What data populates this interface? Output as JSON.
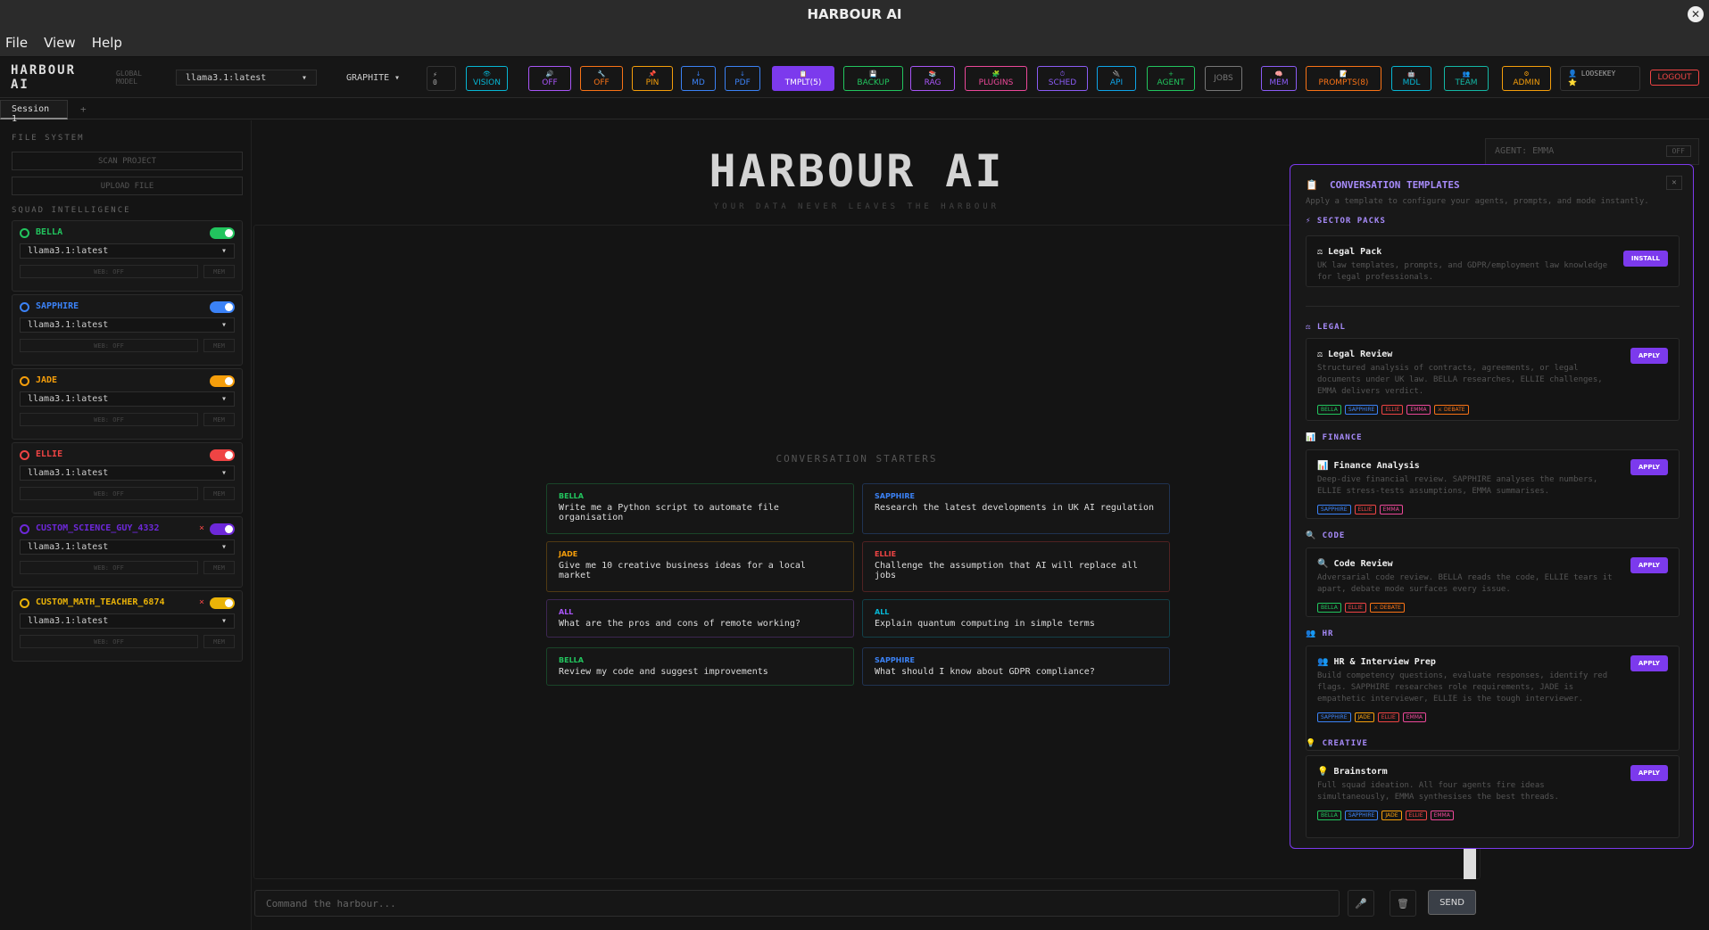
{
  "window": {
    "title": "HARBOUR AI",
    "close_glyph": "✕"
  },
  "menu": [
    "File",
    "View",
    "Help"
  ],
  "toolbar": {
    "brand": "HARBOUR AI",
    "global_model_label": "GLOBAL MODEL",
    "global_model": "llama3.1:latest",
    "theme": "GRAPHITE",
    "counter_icon": "⚡",
    "counter_value": "0",
    "buttons": [
      {
        "icon": "👁",
        "label": "VISION",
        "color": "#06b6d4"
      },
      {
        "icon": "🔊",
        "label": "OFF",
        "color": "#a855f7"
      },
      {
        "icon": "🔧",
        "label": "OFF",
        "color": "#f97316"
      },
      {
        "icon": "📌",
        "label": "PIN",
        "color": "#f59e0b"
      },
      {
        "icon": "↓",
        "label": "MD",
        "color": "#3b82f6"
      },
      {
        "icon": "↓",
        "label": "PDF",
        "color": "#3b82f6"
      },
      {
        "icon": "📋",
        "label": "TMPLT(5)",
        "color": "#7c3aed"
      },
      {
        "icon": "💾",
        "label": "BACKUP",
        "color": "#22c55e"
      },
      {
        "icon": "📚",
        "label": "RAG",
        "color": "#a855f7"
      },
      {
        "icon": "🧩",
        "label": "PLUGINS",
        "color": "#ec4899"
      },
      {
        "icon": "⏱",
        "label": "SCHED",
        "color": "#8b5cf6"
      },
      {
        "icon": "🔌",
        "label": "API",
        "color": "#0ea5e9"
      },
      {
        "icon": "+",
        "label": "AGENT",
        "color": "#22c55e"
      },
      {
        "icon": "",
        "label": "JOBS",
        "color": "#777777"
      },
      {
        "icon": "🧠",
        "label": "MEM",
        "color": "#8b5cf6"
      },
      {
        "icon": "📝",
        "label": "PROMPTS(8)",
        "color": "#f97316"
      },
      {
        "icon": "🤖",
        "label": "MDL",
        "color": "#06b6d4"
      },
      {
        "icon": "👥",
        "label": "TEAM",
        "color": "#14b8a6"
      },
      {
        "icon": "⚙",
        "label": "ADMIN",
        "color": "#f59e0b"
      }
    ],
    "user": "LOOSEKEY",
    "user_star": "⭐",
    "logout": "LOGOUT"
  },
  "tabs": {
    "session": "Session 1",
    "add": "+"
  },
  "sidebar": {
    "file_system_title": "FILE SYSTEM",
    "scan": "SCAN PROJECT",
    "upload": "UPLOAD FILE",
    "squad_title": "SQUAD INTELLIGENCE",
    "agents": [
      {
        "name": "BELLA",
        "color": "#22c55e",
        "model": "llama3.1:latest",
        "web": "WEB: OFF",
        "mem": "MEM",
        "custom": false
      },
      {
        "name": "SAPPHIRE",
        "color": "#3b82f6",
        "model": "llama3.1:latest",
        "web": "WEB: OFF",
        "mem": "MEM",
        "custom": false
      },
      {
        "name": "JADE",
        "color": "#f59e0b",
        "model": "llama3.1:latest",
        "web": "WEB: OFF",
        "mem": "MEM",
        "custom": false
      },
      {
        "name": "ELLIE",
        "color": "#ef4444",
        "model": "llama3.1:latest",
        "web": "WEB: OFF",
        "mem": "MEM",
        "custom": false
      },
      {
        "name": "CUSTOM_SCIENCE_GUY_4332",
        "color": "#6d28d9",
        "model": "llama3.1:latest",
        "web": "WEB: OFF",
        "mem": "MEM",
        "custom": true
      },
      {
        "name": "CUSTOM_MATH_TEACHER_6874",
        "color": "#eab308",
        "model": "llama3.1:latest",
        "web": "WEB: OFF",
        "mem": "MEM",
        "custom": true
      }
    ]
  },
  "main": {
    "hero_title": "HARBOUR AI",
    "hero_sub": "YOUR DATA NEVER LEAVES THE HARBOUR",
    "starters_title": "CONVERSATION STARTERS",
    "starters": [
      {
        "who": "BELLA",
        "text": "Write me a Python script to automate file organisation",
        "color": "#22c55e"
      },
      {
        "who": "SAPPHIRE",
        "text": "Research the latest developments in UK AI regulation",
        "color": "#3b82f6"
      },
      {
        "who": "JADE",
        "text": "Give me 10 creative business ideas for a local market",
        "color": "#f59e0b"
      },
      {
        "who": "ELLIE",
        "text": "Challenge the assumption that AI will replace all jobs",
        "color": "#ef4444"
      },
      {
        "who": "ALL",
        "text": "What are the pros and cons of remote working?",
        "color": "#a855f7"
      },
      {
        "who": "ALL",
        "text": "Explain quantum computing in simple terms",
        "color": "#06b6d4"
      },
      {
        "who": "BELLA",
        "text": "Review my code and suggest improvements",
        "color": "#22c55e"
      },
      {
        "who": "SAPPHIRE",
        "text": "What should I know about GDPR compliance?",
        "color": "#3b82f6"
      }
    ],
    "command_placeholder": "Command the harbour...",
    "mic_icon": "🎤",
    "trash_icon": "🗑",
    "send": "SEND",
    "emma_label": "AGENT: EMMA",
    "emma_state": "OFF"
  },
  "templates": {
    "title": "CONVERSATION TEMPLATES",
    "title_icon": "📋",
    "close": "✕",
    "subtitle": "Apply a template to configure your agents, prompts, and mode instantly.",
    "sector_title": "⚡ SECTOR PACKS",
    "legal_pack": {
      "title": "⚖ Legal Pack",
      "desc": "UK law templates, prompts, and GDPR/employment law knowledge for legal professionals.",
      "btn": "INSTALL"
    },
    "groups": [
      {
        "section": "⚖ LEGAL",
        "title": "⚖ Legal Review",
        "desc": "Structured analysis of contracts, agreements, or legal documents under UK law. BELLA researches, ELLIE challenges, EMMA delivers verdict.",
        "btn": "APPLY",
        "tags": [
          {
            "t": "BELLA",
            "c": "#22c55e"
          },
          {
            "t": "SAPPHIRE",
            "c": "#3b82f6"
          },
          {
            "t": "ELLIE",
            "c": "#ef4444"
          },
          {
            "t": "EMMA",
            "c": "#ec4899"
          },
          {
            "t": "⚔ DEBATE",
            "c": "#f97316"
          }
        ]
      },
      {
        "section": "📊 FINANCE",
        "title": "📊 Finance Analysis",
        "desc": "Deep-dive financial review. SAPPHIRE analyses the numbers, ELLIE stress-tests assumptions, EMMA summarises.",
        "btn": "APPLY",
        "tags": [
          {
            "t": "SAPPHIRE",
            "c": "#3b82f6"
          },
          {
            "t": "ELLIE",
            "c": "#ef4444"
          },
          {
            "t": "EMMA",
            "c": "#ec4899"
          }
        ]
      },
      {
        "section": "🔍 CODE",
        "title": "🔍 Code Review",
        "desc": "Adversarial code review. BELLA reads the code, ELLIE tears it apart, debate mode surfaces every issue.",
        "btn": "APPLY",
        "tags": [
          {
            "t": "BELLA",
            "c": "#22c55e"
          },
          {
            "t": "ELLIE",
            "c": "#ef4444"
          },
          {
            "t": "⚔ DEBATE",
            "c": "#f97316"
          }
        ]
      },
      {
        "section": "👥 HR",
        "title": "👥 HR & Interview Prep",
        "desc": "Build competency questions, evaluate responses, identify red flags. SAPPHIRE researches role requirements, JADE is empathetic interviewer, ELLIE is the tough interviewer.",
        "btn": "APPLY",
        "tags": [
          {
            "t": "SAPPHIRE",
            "c": "#3b82f6"
          },
          {
            "t": "JADE",
            "c": "#f59e0b"
          },
          {
            "t": "ELLIE",
            "c": "#ef4444"
          },
          {
            "t": "EMMA",
            "c": "#ec4899"
          }
        ]
      },
      {
        "section": "💡 CREATIVE",
        "title": "💡 Brainstorm",
        "desc": "Full squad ideation. All four agents fire ideas simultaneously, EMMA synthesises the best threads.",
        "btn": "APPLY",
        "tags": [
          {
            "t": "BELLA",
            "c": "#22c55e"
          },
          {
            "t": "SAPPHIRE",
            "c": "#3b82f6"
          },
          {
            "t": "JADE",
            "c": "#f59e0b"
          },
          {
            "t": "ELLIE",
            "c": "#ef4444"
          },
          {
            "t": "EMMA",
            "c": "#ec4899"
          }
        ]
      }
    ]
  }
}
